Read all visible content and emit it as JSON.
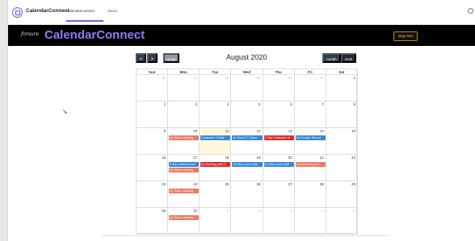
{
  "topnav": {
    "app_name": "CalendarConnect",
    "links": [
      "CalendarConnect",
      "About"
    ]
  },
  "banner": {
    "brand": "forsure",
    "title": "CalendarConnect",
    "signout": "Sign Out"
  },
  "toolbar": {
    "prev": "<",
    "next": ">",
    "today": "today",
    "title": "August 2020",
    "month": "month",
    "work": "work"
  },
  "calendar": {
    "days": [
      "Sun",
      "Mon",
      "Tue",
      "Wed",
      "Thu",
      "Fri",
      "Sat"
    ],
    "weeks": [
      [
        "26",
        "27",
        "28",
        "29",
        "30",
        "31",
        "1"
      ],
      [
        "2",
        "3",
        "4",
        "5",
        "6",
        "7",
        "8"
      ],
      [
        "9",
        "10",
        "11",
        "12",
        "13",
        "14",
        "15"
      ],
      [
        "16",
        "17",
        "18",
        "19",
        "20",
        "21",
        "22"
      ],
      [
        "23",
        "24",
        "25",
        "26",
        "27",
        "28",
        "29"
      ],
      [
        "30",
        "31",
        "1",
        "2",
        "3",
        "4",
        "5"
      ]
    ],
    "events": [
      {
        "text": "5p Team meeting",
        "week": 2,
        "day": 1,
        "slot": 0,
        "color": "#ee7b63"
      },
      {
        "text": "Customer Onsite",
        "week": 2,
        "day": 2,
        "slot": 0,
        "color": "#3788d8"
      },
      {
        "text": "1p Test CC Demo",
        "week": 2,
        "day": 3,
        "slot": 0,
        "color": "#3788d8"
      },
      {
        "text": "2:30p Customer M",
        "week": 2,
        "day": 4,
        "slot": 0,
        "color": "#d92b2b"
      },
      {
        "text": "3a Forsyte Round",
        "week": 2,
        "day": 5,
        "slot": 0,
        "color": "#3788d8"
      },
      {
        "text": "2:30p Internal mee",
        "week": 3,
        "day": 1,
        "slot": 0,
        "color": "#3788d8"
      },
      {
        "text": "5p Team meeting",
        "week": 3,
        "day": 1,
        "slot": 1,
        "color": "#ee7b63"
      },
      {
        "text": "5p Meeting with C",
        "week": 3,
        "day": 2,
        "slot": 0,
        "color": "#d92b2b"
      },
      {
        "text": "11:30a Lunch with",
        "week": 3,
        "day": 3,
        "slot": 0,
        "color": "#3788d8"
      },
      {
        "text": "11:30a Lunch with",
        "week": 3,
        "day": 4,
        "slot": 0,
        "color": "#3788d8"
      },
      {
        "text": "10a Meeting all o",
        "week": 3,
        "day": 5,
        "slot": 0,
        "color": "#ee7b63"
      },
      {
        "text": "5p Team meeting",
        "week": 4,
        "day": 1,
        "slot": 0,
        "color": "#ee7b63"
      },
      {
        "text": "5p Team meeting",
        "week": 5,
        "day": 1,
        "slot": 0,
        "color": "#ee7b63"
      }
    ],
    "today": {
      "week": 2,
      "day": 2
    }
  }
}
